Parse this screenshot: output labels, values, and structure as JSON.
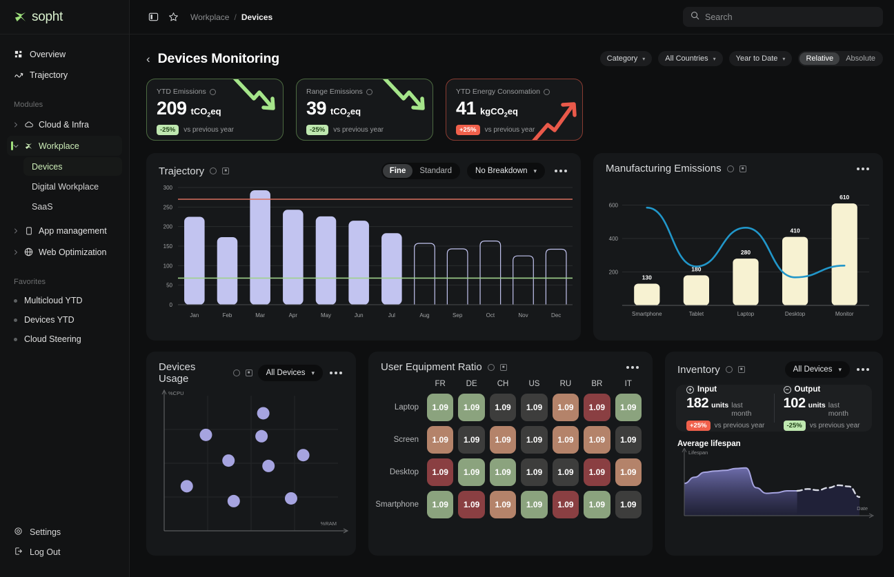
{
  "brand": {
    "name": "sopht"
  },
  "sidebar": {
    "top": [
      {
        "label": "Overview",
        "icon": "grid-icon"
      },
      {
        "label": "Trajectory",
        "icon": "trend-icon"
      }
    ],
    "modules_label": "Modules",
    "modules": [
      {
        "label": "Cloud & Infra",
        "icon": "cloud-icon",
        "active": false
      },
      {
        "label": "Workplace",
        "icon": "workplace-icon",
        "active": true
      }
    ],
    "sub_items": [
      {
        "label": "Devices",
        "active": true
      },
      {
        "label": "Digital Workplace",
        "active": false
      },
      {
        "label": "SaaS",
        "active": false
      }
    ],
    "modules_more": [
      {
        "label": "App management",
        "icon": "mobile-icon"
      },
      {
        "label": "Web Optimization",
        "icon": "globe-icon"
      }
    ],
    "favorites_label": "Favorites",
    "favorites": [
      {
        "label": "Multicloud YTD"
      },
      {
        "label": "Devices YTD"
      },
      {
        "label": "Cloud Steering"
      }
    ],
    "bottom": [
      {
        "label": "Settings",
        "icon": "gear-icon"
      },
      {
        "label": "Log Out",
        "icon": "logout-icon"
      }
    ]
  },
  "topbar": {
    "breadcrumb": {
      "parent": "Workplace",
      "sep": "/",
      "current": "Devices"
    },
    "search_placeholder": "Search",
    "search_value": ""
  },
  "page": {
    "title": "Devices Monitoring",
    "back": "‹",
    "filters": [
      {
        "label": "Category",
        "name": "category-filter"
      },
      {
        "label": "All Countries",
        "name": "country-filter"
      },
      {
        "label": "Year to Date",
        "name": "period-filter"
      }
    ],
    "mode_toggle": {
      "relative": "Relative",
      "absolute": "Absolute",
      "selected": "Relative"
    }
  },
  "kpis": [
    {
      "label": "YTD Emissions",
      "value": "209",
      "unit_pre": "tCO",
      "unit_sub": "2",
      "unit_post": "eq",
      "badge": "-25%",
      "badge_dir": "down",
      "compare": "vs previous year",
      "tone": "green"
    },
    {
      "label": "Range Emissions",
      "value": "39",
      "unit_pre": "tCO",
      "unit_sub": "2",
      "unit_post": "eq",
      "badge": "-25%",
      "badge_dir": "down",
      "compare": "vs previous year",
      "tone": "green"
    },
    {
      "label": "YTD Energy Consomation",
      "value": "41",
      "unit_pre": "kgCO",
      "unit_sub": "2",
      "unit_post": "eq",
      "badge": "+25%",
      "badge_dir": "up",
      "compare": "vs previous year",
      "tone": "red"
    }
  ],
  "trajectory": {
    "title": "Trajectory",
    "granularity": {
      "fine": "Fine",
      "standard": "Standard",
      "selected": "Fine"
    },
    "breakdown": "No Breakdown",
    "menu": "more-menu"
  },
  "manufacturing": {
    "title": "Manufacturing Emissions",
    "menu": "more-menu"
  },
  "usage": {
    "title": "Devices Usage",
    "device_filter": "All Devices",
    "menu": "more-menu"
  },
  "heatmap_panel": {
    "title": "User Equipment Ratio",
    "menu": "more-menu"
  },
  "inventory": {
    "title": "Inventory",
    "device_filter": "All Devices",
    "menu": "more-menu",
    "input": {
      "label": "Input",
      "value": "182",
      "unit": "units",
      "suffix": "last month",
      "badge": "+25%",
      "badge_dir": "up",
      "compare": "vs previous year"
    },
    "output": {
      "label": "Output",
      "value": "102",
      "unit": "units",
      "suffix": "last month",
      "badge": "-25%",
      "badge_dir": "down",
      "compare": "vs previous year"
    },
    "lifespan_title": "Average lifespan",
    "y_axis": "Lifespan",
    "x_axis": "Date"
  },
  "chart_data": [
    {
      "type": "bar",
      "id": "trajectory-chart",
      "title": "Trajectory",
      "categories": [
        "Jan",
        "Feb",
        "Mar",
        "Apr",
        "May",
        "Jun",
        "Jul",
        "Aug",
        "Sep",
        "Oct",
        "Nov",
        "Dec"
      ],
      "values": [
        225,
        173,
        293,
        243,
        226,
        215,
        183,
        157,
        143,
        163,
        125,
        142
      ],
      "filled": [
        true,
        true,
        true,
        true,
        true,
        true,
        true,
        false,
        false,
        false,
        false,
        false
      ],
      "yticks": [
        0,
        50,
        100,
        150,
        200,
        250,
        300
      ],
      "ylim": [
        0,
        300
      ],
      "xlabel": "",
      "ylabel": "",
      "grid": true,
      "reference_lines": [
        {
          "name": "target-ceiling",
          "value": 270,
          "color": "#d9705f"
        },
        {
          "name": "target-floor",
          "value": 68,
          "color": "#9fd18b"
        }
      ],
      "bar_color": "#c2c4f0",
      "outline_color": "#c2c4f0"
    },
    {
      "type": "bar",
      "id": "manufacturing-emissions-chart",
      "title": "Manufacturing Emissions",
      "categories": [
        "Smartphone",
        "Tablet",
        "Laptop",
        "Desktop",
        "Monitor"
      ],
      "values": [
        130,
        180,
        280,
        410,
        610
      ],
      "data_labels": [
        "130",
        "180",
        "280",
        "410",
        "610"
      ],
      "yticks": [
        200,
        400,
        600
      ],
      "ylim": [
        0,
        660
      ],
      "grid": true,
      "bar_color": "#f7f2d2",
      "series": [
        {
          "name": "trend-line",
          "type": "line",
          "color": "#2196c9",
          "values": [
            585,
            233,
            465,
            168,
            238
          ]
        }
      ]
    },
    {
      "type": "scatter",
      "id": "devices-usage-chart",
      "title": "Devices Usage",
      "xlabel": "%RAM",
      "ylabel": "%CPU",
      "grid": true,
      "point_color": "#a6a4e0",
      "points": [
        {
          "x": 0.57,
          "y": 0.87
        },
        {
          "x": 0.24,
          "y": 0.71
        },
        {
          "x": 0.56,
          "y": 0.7
        },
        {
          "x": 0.8,
          "y": 0.56
        },
        {
          "x": 0.37,
          "y": 0.52
        },
        {
          "x": 0.6,
          "y": 0.48
        },
        {
          "x": 0.13,
          "y": 0.33
        },
        {
          "x": 0.4,
          "y": 0.22
        },
        {
          "x": 0.73,
          "y": 0.24
        }
      ]
    },
    {
      "type": "heatmap",
      "id": "user-equipment-ratio-chart",
      "title": "User Equipment Ratio",
      "columns": [
        "FR",
        "DE",
        "CH",
        "US",
        "RU",
        "BR",
        "IT"
      ],
      "rows": [
        "Laptop",
        "Screen",
        "Desktop",
        "Smartphone"
      ],
      "values": [
        [
          "1.09",
          "1.09",
          "1.09",
          "1.09",
          "1.09",
          "1.09",
          "1.09"
        ],
        [
          "1.09",
          "1.09",
          "1.09",
          "1.09",
          "1.09",
          "1.09",
          "1.09"
        ],
        [
          "1.09",
          "1.09",
          "1.09",
          "1.09",
          "1.09",
          "1.09",
          "1.09"
        ],
        [
          "1.09",
          "1.09",
          "1.09",
          "1.09",
          "1.09",
          "1.09",
          "1.09"
        ]
      ],
      "cell_colors": [
        [
          "#8ba37e",
          "#8ba37e",
          "#3d3d3c",
          "#3d3d3c",
          "#b4836a",
          "#8a3f42",
          "#8ba37e"
        ],
        [
          "#b4836a",
          "#3d3d3c",
          "#b4836a",
          "#3d3d3c",
          "#b4836a",
          "#b4836a",
          "#3d3d3c"
        ],
        [
          "#8a3f42",
          "#8ba37e",
          "#8ba37e",
          "#3d3d3c",
          "#3d3d3c",
          "#8a3f42",
          "#b4836a"
        ],
        [
          "#8ba37e",
          "#8a3f42",
          "#b4836a",
          "#8ba37e",
          "#8a3f42",
          "#8ba37e",
          "#3d3d3c"
        ]
      ],
      "palette": {
        "green": "#8ba37e",
        "neutral": "#3d3d3c",
        "tan": "#b4836a",
        "red": "#8a3f42"
      }
    },
    {
      "type": "area",
      "id": "average-lifespan-chart",
      "title": "Average lifespan",
      "xlabel": "Date",
      "ylabel": "Lifespan",
      "line_color": "#a6a4e0",
      "forecast_color": "#d9dbe6",
      "forecast_dashed": true,
      "values": [
        0.52,
        0.62,
        0.7,
        0.72,
        0.73,
        0.76,
        0.77,
        0.45,
        0.36,
        0.37,
        0.4,
        0.4
      ],
      "forecast_values": [
        0.4,
        0.43,
        0.41,
        0.45,
        0.49,
        0.47,
        0.3
      ]
    }
  ]
}
